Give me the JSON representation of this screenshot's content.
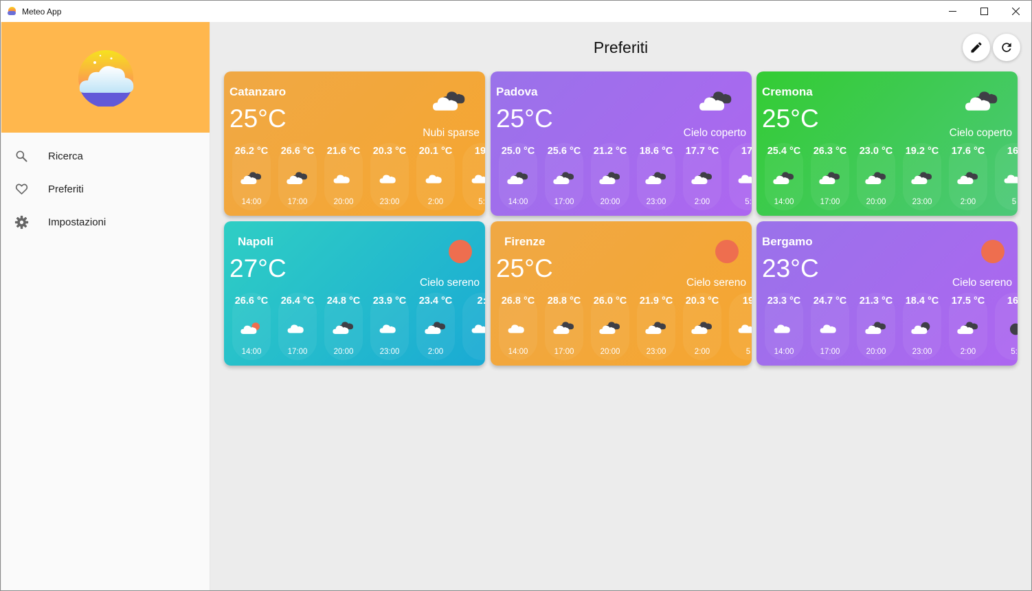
{
  "window": {
    "title": "Meteo App"
  },
  "sidebar": {
    "items": [
      {
        "label": "Ricerca",
        "icon": "search-icon"
      },
      {
        "label": "Preferiti",
        "icon": "heart-icon"
      },
      {
        "label": "Impostazioni",
        "icon": "gear-icon"
      }
    ]
  },
  "main": {
    "title": "Preferiti"
  },
  "colors": {
    "sidebar_header": "#ffb74d",
    "orange": "#f2a23a",
    "purple": "#a36ee8",
    "green": "#3dcb45",
    "cyan": "#27c3c8",
    "sun": "#ee6e4f"
  },
  "cards": [
    {
      "city": "Catanzaro",
      "temp": "25°C",
      "desc": "Nubi sparse",
      "icon": "broken-clouds-icon",
      "theme": "orange",
      "hours": [
        {
          "temp": "26.2 °C",
          "time": "14:00",
          "icon": "broken-clouds-icon"
        },
        {
          "temp": "26.6 °C",
          "time": "17:00",
          "icon": "broken-clouds-icon"
        },
        {
          "temp": "21.6 °C",
          "time": "20:00",
          "icon": "cloud-icon"
        },
        {
          "temp": "20.3 °C",
          "time": "23:00",
          "icon": "cloud-icon"
        },
        {
          "temp": "20.1 °C",
          "time": "2:00",
          "icon": "cloud-icon"
        },
        {
          "temp": "19.",
          "time": "5:",
          "icon": "cloud-icon"
        }
      ]
    },
    {
      "city": "Padova",
      "temp": "25°C",
      "desc": "Cielo coperto",
      "icon": "broken-clouds-icon",
      "theme": "purple",
      "hours": [
        {
          "temp": "25.0 °C",
          "time": "14:00",
          "icon": "broken-clouds-icon"
        },
        {
          "temp": "25.6 °C",
          "time": "17:00",
          "icon": "broken-clouds-icon"
        },
        {
          "temp": "21.2 °C",
          "time": "20:00",
          "icon": "broken-clouds-icon"
        },
        {
          "temp": "18.6 °C",
          "time": "23:00",
          "icon": "broken-clouds-icon"
        },
        {
          "temp": "17.7 °C",
          "time": "2:00",
          "icon": "broken-clouds-icon"
        },
        {
          "temp": "17.",
          "time": "5:",
          "icon": "cloud-icon"
        }
      ]
    },
    {
      "city": "Cremona",
      "temp": "25°C",
      "desc": "Cielo coperto",
      "icon": "broken-clouds-icon",
      "theme": "green",
      "hours": [
        {
          "temp": "25.4 °C",
          "time": "14:00",
          "icon": "broken-clouds-icon"
        },
        {
          "temp": "26.3 °C",
          "time": "17:00",
          "icon": "broken-clouds-icon"
        },
        {
          "temp": "23.0 °C",
          "time": "20:00",
          "icon": "broken-clouds-icon"
        },
        {
          "temp": "19.2 °C",
          "time": "23:00",
          "icon": "broken-clouds-icon"
        },
        {
          "temp": "17.6 °C",
          "time": "2:00",
          "icon": "broken-clouds-icon"
        },
        {
          "temp": "16.",
          "time": "5",
          "icon": "cloud-icon"
        }
      ]
    },
    {
      "city": "Napoli",
      "temp": "27°C",
      "desc": "Cielo sereno",
      "icon": "sun-icon",
      "theme": "cyan",
      "hours": [
        {
          "temp": "26.6 °C",
          "time": "14:00",
          "icon": "few-clouds-icon"
        },
        {
          "temp": "26.4 °C",
          "time": "17:00",
          "icon": "cloud-icon"
        },
        {
          "temp": "24.8 °C",
          "time": "20:00",
          "icon": "broken-clouds-icon"
        },
        {
          "temp": "23.9 °C",
          "time": "23:00",
          "icon": "cloud-icon"
        },
        {
          "temp": "23.4 °C",
          "time": "2:00",
          "icon": "broken-clouds-icon"
        },
        {
          "temp": "2:",
          "time": "",
          "icon": "cloud-icon"
        }
      ]
    },
    {
      "city": "Firenze",
      "temp": "25°C",
      "desc": "Cielo sereno",
      "icon": "sun-icon",
      "theme": "orange",
      "hours": [
        {
          "temp": "26.8 °C",
          "time": "14:00",
          "icon": "cloud-icon"
        },
        {
          "temp": "28.8 °C",
          "time": "17:00",
          "icon": "broken-clouds-icon"
        },
        {
          "temp": "26.0 °C",
          "time": "20:00",
          "icon": "broken-clouds-icon"
        },
        {
          "temp": "21.9 °C",
          "time": "23:00",
          "icon": "broken-clouds-icon"
        },
        {
          "temp": "20.3 °C",
          "time": "2:00",
          "icon": "broken-clouds-icon"
        },
        {
          "temp": "19",
          "time": "5",
          "icon": "cloud-icon"
        }
      ]
    },
    {
      "city": "Bergamo",
      "temp": "23°C",
      "desc": "Cielo sereno",
      "icon": "sun-icon",
      "theme": "purple",
      "hours": [
        {
          "temp": "23.3 °C",
          "time": "14:00",
          "icon": "cloud-icon"
        },
        {
          "temp": "24.7 °C",
          "time": "17:00",
          "icon": "cloud-icon"
        },
        {
          "temp": "21.3 °C",
          "time": "20:00",
          "icon": "broken-clouds-icon"
        },
        {
          "temp": "18.4 °C",
          "time": "23:00",
          "icon": "cloud-moon-icon"
        },
        {
          "temp": "17.5 °C",
          "time": "2:00",
          "icon": "broken-clouds-icon"
        },
        {
          "temp": "16.",
          "time": "5:",
          "icon": "moon-icon"
        }
      ]
    }
  ]
}
